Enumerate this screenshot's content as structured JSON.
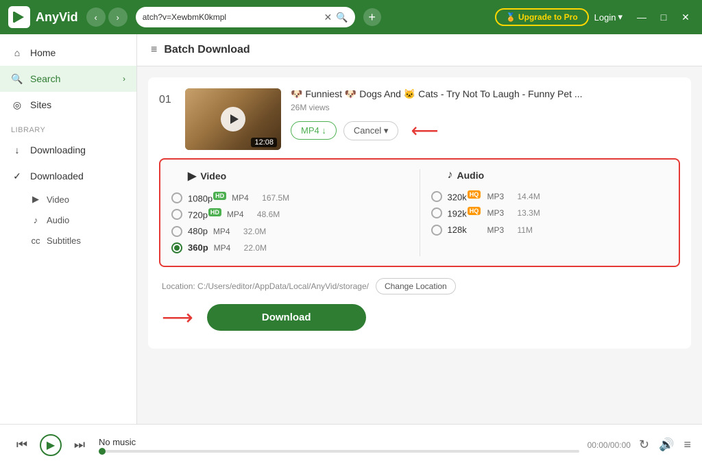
{
  "app": {
    "name": "AnyVid",
    "logo_text": "AnyVid"
  },
  "titlebar": {
    "url": "atch?v=XewbmK0kmpl",
    "upgrade_label": "🏅 Upgrade to Pro",
    "login_label": "Login",
    "login_chevron": "▾"
  },
  "sidebar": {
    "home_label": "Home",
    "search_label": "Search",
    "sites_label": "Sites",
    "library_label": "Library",
    "downloading_label": "Downloading",
    "downloaded_label": "Downloaded",
    "video_label": "Video",
    "audio_label": "Audio",
    "subtitles_label": "Subtitles"
  },
  "page": {
    "title": "Batch Download"
  },
  "video": {
    "number": "01",
    "duration": "12:08",
    "title": "🐶 Funniest 🐶 Dogs And 🐱 Cats - Try Not To Laugh - Funny Pet ...",
    "views": "26M views",
    "format_btn": "MP4 ↓",
    "cancel_btn": "Cancel ▾"
  },
  "formats": {
    "video_header": "Video",
    "audio_header": "Audio",
    "video_options": [
      {
        "res": "1080p",
        "badge": "HD",
        "type": "MP4",
        "size": "167.5M",
        "selected": false
      },
      {
        "res": "720p",
        "badge": "HD",
        "type": "MP4",
        "size": "48.6M",
        "selected": false
      },
      {
        "res": "480p",
        "badge": "",
        "type": "MP4",
        "size": "32.0M",
        "selected": false
      },
      {
        "res": "360p",
        "badge": "",
        "type": "MP4",
        "size": "22.0M",
        "selected": true
      }
    ],
    "audio_options": [
      {
        "freq": "320k",
        "badge": "HQ",
        "type": "MP3",
        "size": "14.4M",
        "selected": false
      },
      {
        "freq": "192k",
        "badge": "HQ",
        "type": "MP3",
        "size": "13.3M",
        "selected": false
      },
      {
        "freq": "128k",
        "badge": "",
        "type": "MP3",
        "size": "11M",
        "selected": false
      }
    ]
  },
  "location": {
    "label": "Location:",
    "path": "C:/Users/editor/AppData/Local/AnyVid/storage/",
    "change_btn": "Change Location"
  },
  "download": {
    "btn_label": "Download"
  },
  "player": {
    "title": "No music",
    "time": "00:00/00:00",
    "progress": 0
  }
}
